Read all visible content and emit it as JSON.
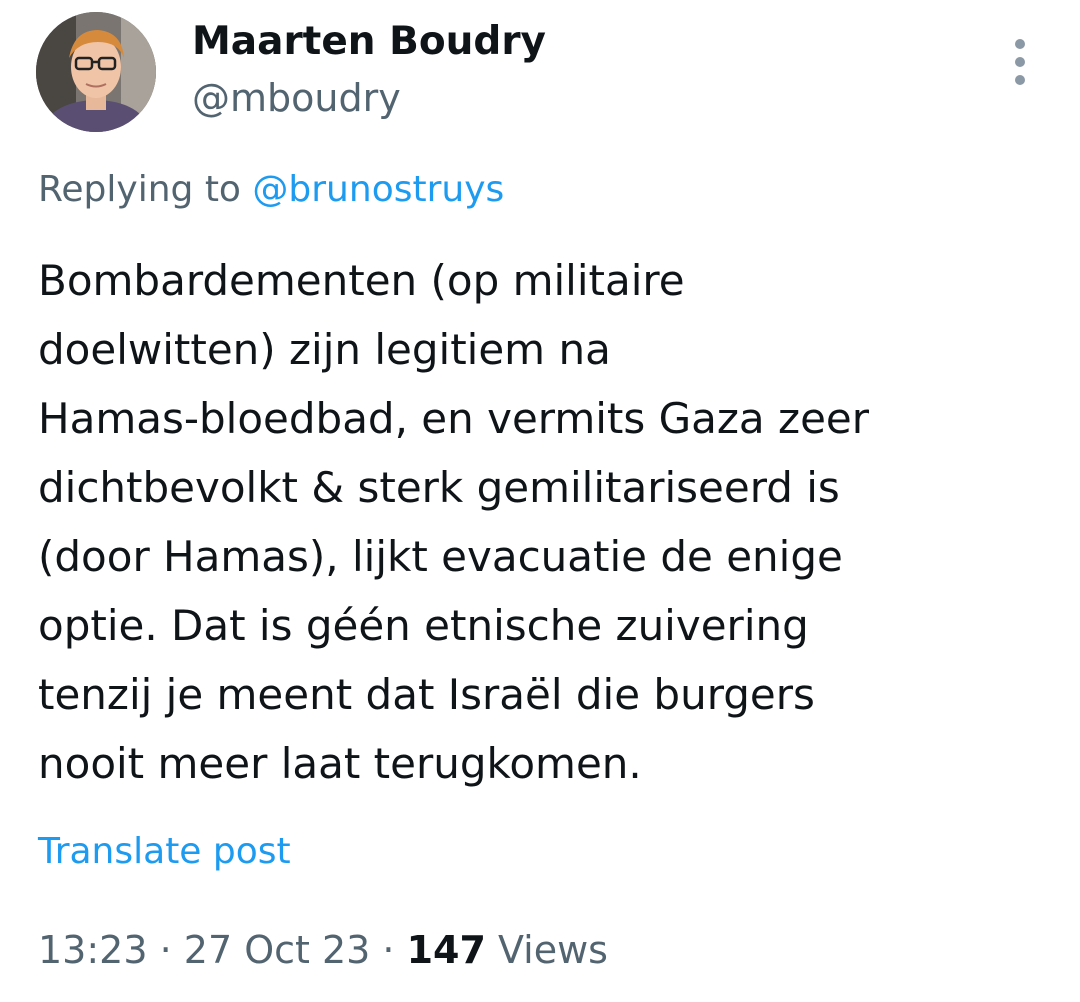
{
  "author": {
    "display_name": "Maarten Boudry",
    "handle": "@mboudry"
  },
  "reply": {
    "prefix": "Replying to ",
    "to_handle": "@brunostruys"
  },
  "tweet": {
    "text": "Bombardementen (op militaire\ndoelwitten) zijn legitiem na\nHamas-bloedbad, en vermits Gaza zeer\ndichtbevolkt & sterk gemilitariseerd is\n(door Hamas), lijkt evacuatie de enige\noptie. Dat is géén etnische zuivering\ntenzij je meent dat Israël die burgers\nnooit meer laat terugkomen.",
    "translate_label": "Translate post"
  },
  "meta": {
    "time": "13:23",
    "separator": " · ",
    "date": "27 Oct 23",
    "views_count": "147",
    "views_label": " Views"
  },
  "icons": {
    "more": "more-vertical-icon",
    "avatar": "profile-photo"
  },
  "colors": {
    "link": "#1d9bf0",
    "secondary_text": "#536471",
    "primary_text": "#0f1419"
  }
}
